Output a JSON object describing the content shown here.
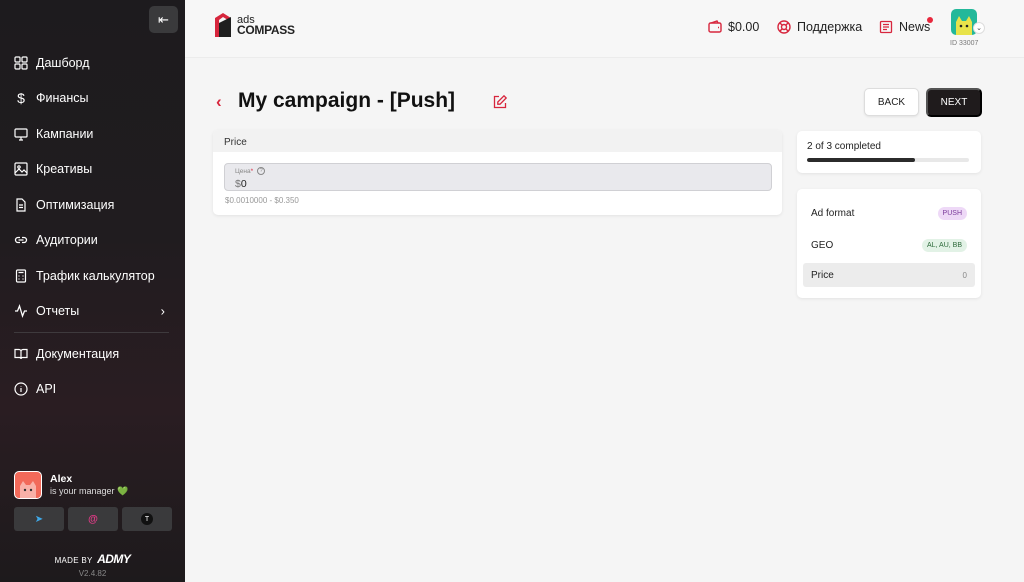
{
  "sidebar": {
    "collapse_icon": "collapse-left-icon",
    "items": [
      {
        "label": "Дашборд",
        "icon": "dashboard-grid-icon"
      },
      {
        "label": "Финансы",
        "icon": "dollar-icon"
      },
      {
        "label": "Кампании",
        "icon": "monitor-icon"
      },
      {
        "label": "Креативы",
        "icon": "image-icon"
      },
      {
        "label": "Оптимизация",
        "icon": "document-icon"
      },
      {
        "label": "Аудитории",
        "icon": "link-icon"
      },
      {
        "label": "Трафик калькулятор",
        "icon": "calculator-icon"
      },
      {
        "label": "Отчеты",
        "icon": "activity-icon"
      }
    ],
    "secondary_items": [
      {
        "label": "Документация",
        "icon": "book-icon"
      },
      {
        "label": "API",
        "icon": "info-icon"
      }
    ],
    "manager": {
      "name": "Alex",
      "subtitle": "is your manager 💚",
      "contacts": [
        {
          "icon": "telegram-icon",
          "glyph": "➤"
        },
        {
          "icon": "email-at-icon",
          "glyph": "@"
        },
        {
          "icon": "tawk-icon",
          "glyph": "T"
        }
      ]
    },
    "made_by": "MADE BY",
    "made_by_brand": "ADMY",
    "version": "V2.4.82"
  },
  "header": {
    "logo_ads": "ads",
    "logo_compass": "COMPASS",
    "balance": "$0.00",
    "support": "Поддержка",
    "news": "News",
    "user_id": "ID 33007"
  },
  "main": {
    "title": "My campaign - [Push]",
    "back_button": "BACK",
    "next_button": "NEXT",
    "price_section": {
      "header": "Price",
      "field_label": "Цена",
      "field_required_mark": "*",
      "field_help": "?",
      "currency": "$",
      "value": "0",
      "range": "$0.0010000 - $0.350"
    },
    "progress": {
      "text": "2 of 3 completed",
      "fraction": 0.667
    },
    "steps": [
      {
        "label": "Ad format",
        "value": "PUSH"
      },
      {
        "label": "GEO",
        "value": "AL, AU, BB"
      },
      {
        "label": "Price",
        "value": "0"
      }
    ]
  },
  "colors": {
    "accent": "#d7263d",
    "sidebar_bg": "#1d1b1e",
    "primary_button": "#1f1b1c",
    "push_badge_bg": "#eed9f7",
    "geo_badge_bg": "#e2f2e6"
  }
}
